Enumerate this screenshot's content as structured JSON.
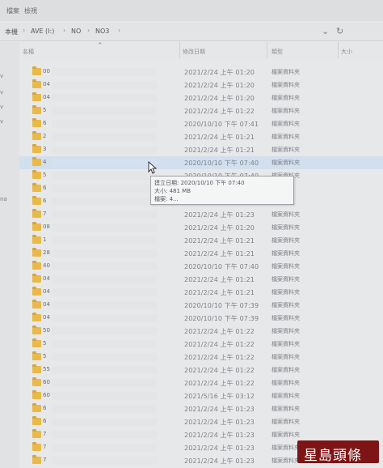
{
  "menu": {
    "item1": "檔案",
    "item2": "檢視"
  },
  "address": {
    "crumbs": [
      "本機",
      "AVE (I:)",
      "NO",
      "NO3"
    ],
    "refresh_icon": "refresh-icon",
    "dropdown_icon": "chevron-down-icon"
  },
  "columns": {
    "name": "名稱",
    "modified": "修改日期",
    "type": "類型",
    "size": "大小"
  },
  "rows": [
    {
      "name": "00",
      "date": "2021/2/24 上午 01:20",
      "type": "檔案資料夾"
    },
    {
      "name": "04",
      "date": "2021/2/24 上午 01:20",
      "type": "檔案資料夾"
    },
    {
      "name": "04",
      "date": "2021/2/24 上午 01:20",
      "type": "檔案資料夾"
    },
    {
      "name": "5",
      "date": "2021/2/24 上午 01:22",
      "type": "檔案資料夾"
    },
    {
      "name": "6",
      "date": "2020/10/10 下午 07:41",
      "type": "檔案資料夾"
    },
    {
      "name": "2",
      "date": "2021/2/24 上午 01:21",
      "type": "檔案資料夾"
    },
    {
      "name": "3",
      "date": "2021/2/24 上午 01:21",
      "type": "檔案資料夾"
    },
    {
      "name": "4",
      "date": "2020/10/10 下午 07:40",
      "type": "檔案資料夾"
    },
    {
      "name": "5",
      "date": "2020/10/10 下午 07:40",
      "type": "檔案資料夾"
    },
    {
      "name": "6",
      "date": "",
      "type": ""
    },
    {
      "name": "6",
      "date": "",
      "type": ""
    },
    {
      "name": "7",
      "date": "2021/2/24 上午 01:23",
      "type": "檔案資料夾"
    },
    {
      "name": "08",
      "date": "2021/2/24 上午 01:20",
      "type": "檔案資料夾"
    },
    {
      "name": "1",
      "date": "2021/2/24 上午 01:21",
      "type": "檔案資料夾"
    },
    {
      "name": "28",
      "date": "2021/2/24 上午 01:21",
      "type": "檔案資料夾"
    },
    {
      "name": "40",
      "date": "2020/10/10 下午 07:40",
      "type": "檔案資料夾"
    },
    {
      "name": "04",
      "date": "2021/2/24 上午 01:21",
      "type": "檔案資料夾"
    },
    {
      "name": "04",
      "date": "2021/2/24 上午 01:21",
      "type": "檔案資料夾"
    },
    {
      "name": "04",
      "date": "2020/10/10 下午 07:39",
      "type": "檔案資料夾"
    },
    {
      "name": "04",
      "date": "2020/10/10 下午 07:39",
      "type": "檔案資料夾"
    },
    {
      "name": "50",
      "date": "2021/2/24 上午 01:22",
      "type": "檔案資料夾"
    },
    {
      "name": "5",
      "date": "2021/2/24 上午 01:22",
      "type": "檔案資料夾"
    },
    {
      "name": "5",
      "date": "2021/2/24 上午 01:22",
      "type": "檔案資料夾"
    },
    {
      "name": "55",
      "date": "2021/2/24 上午 01:22",
      "type": "檔案資料夾"
    },
    {
      "name": "60",
      "date": "2021/2/24 上午 01:22",
      "type": "檔案資料夾"
    },
    {
      "name": "60",
      "date": "2021/5/16 上午 03:12",
      "type": "檔案資料夾"
    },
    {
      "name": "6",
      "date": "2021/2/24 上午 01:23",
      "type": "檔案資料夾"
    },
    {
      "name": "6",
      "date": "2021/2/24 上午 01:23",
      "type": "檔案資料夾"
    },
    {
      "name": "7",
      "date": "2021/2/24 上午 01:23",
      "type": "檔案資料夾"
    },
    {
      "name": "7",
      "date": "2021/2/24 上午 01:23",
      "type": "檔案資料夾"
    },
    {
      "name": "7",
      "date": "2021/2/24 上午 01:23",
      "type": "檔案資料夾"
    },
    {
      "name": "7",
      "date": "2021/2/24 上午 01:23",
      "type": "檔案資料夾"
    }
  ],
  "tooltip": {
    "created": "建立日期: 2020/10/10 下午 07:40",
    "size": "大小: 481 MB",
    "files": "檔案: 4..."
  },
  "left_pane": {
    "marks": [
      "v",
      "v",
      "v",
      "v",
      "na"
    ]
  },
  "watermark": {
    "text": "星島頭條"
  }
}
